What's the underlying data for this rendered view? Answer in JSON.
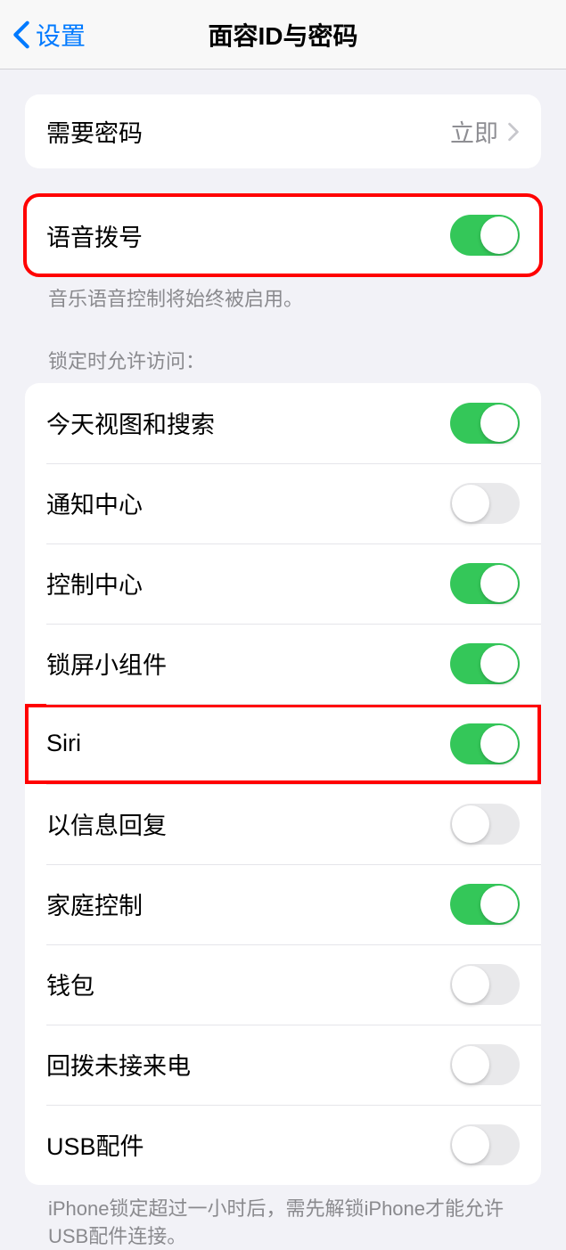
{
  "header": {
    "back_label": "设置",
    "title": "面容ID与密码"
  },
  "passcode_section": {
    "label": "需要密码",
    "value": "立即"
  },
  "voice_dial": {
    "label": "语音拨号",
    "on": true,
    "footer": "音乐语音控制将始终被启用。"
  },
  "lock_access": {
    "header": "锁定时允许访问：",
    "items": [
      {
        "label": "今天视图和搜索",
        "on": true,
        "highlight": false
      },
      {
        "label": "通知中心",
        "on": false,
        "highlight": false
      },
      {
        "label": "控制中心",
        "on": true,
        "highlight": false
      },
      {
        "label": "锁屏小组件",
        "on": true,
        "highlight": false
      },
      {
        "label": "Siri",
        "on": true,
        "highlight": true
      },
      {
        "label": "以信息回复",
        "on": false,
        "highlight": false
      },
      {
        "label": "家庭控制",
        "on": true,
        "highlight": false
      },
      {
        "label": "钱包",
        "on": false,
        "highlight": false
      },
      {
        "label": "回拨未接来电",
        "on": false,
        "highlight": false
      },
      {
        "label": "USB配件",
        "on": false,
        "highlight": false
      }
    ],
    "footer": "iPhone锁定超过一小时后，需先解锁iPhone才能允许USB配件连接。"
  }
}
